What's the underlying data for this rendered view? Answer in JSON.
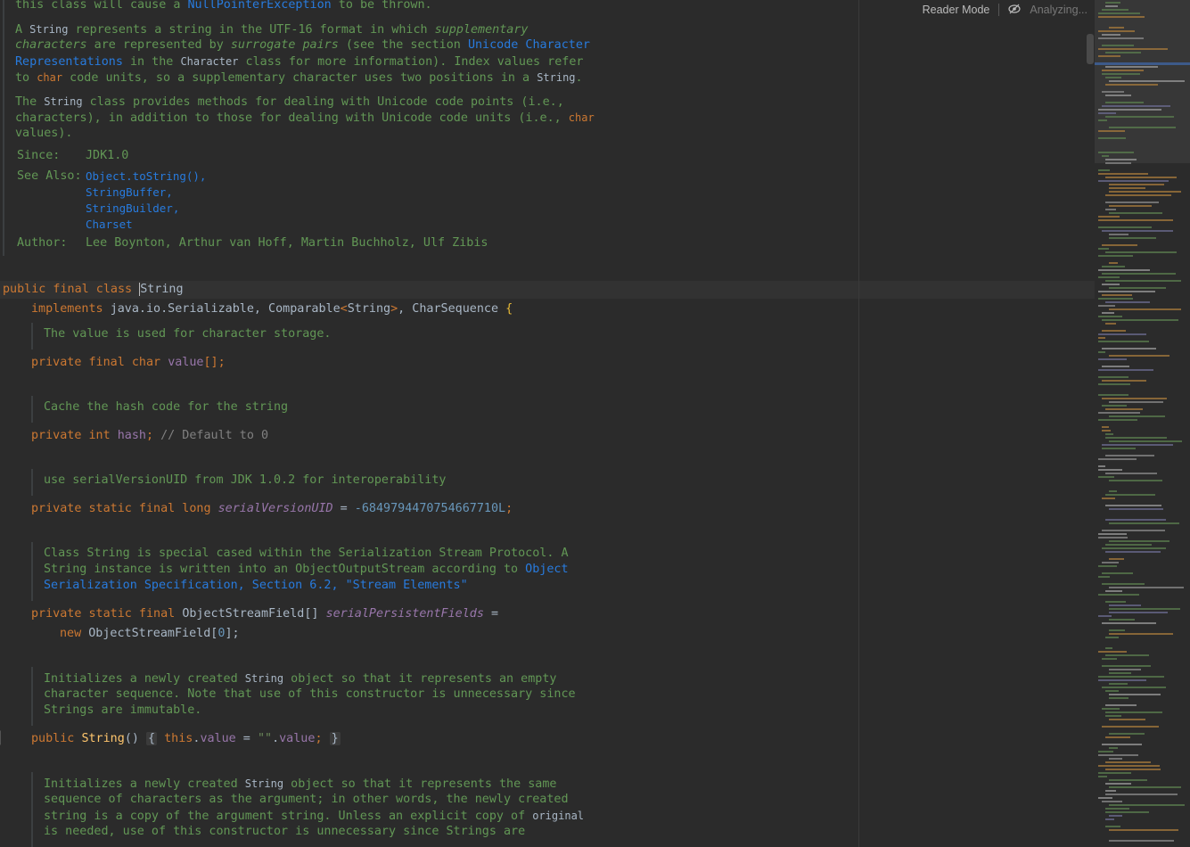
{
  "toolbar": {
    "reader_mode": "Reader Mode",
    "analyzing": "Analyzing..."
  },
  "doc_top": {
    "l1_a": "this class will cause a ",
    "l1_link": "NullPointerException",
    "l1_b": " to be thrown.",
    "p1_l1_a": "A ",
    "p1_l1_code": "String",
    "p1_l1_b": " represents a string in the UTF-16 format in which ",
    "p1_l1_i": "supplementary",
    "p1_l2_i": "characters",
    "p1_l2_a": " are represented by ",
    "p1_l2_i2": "surrogate pairs",
    "p1_l2_b": " (see the section ",
    "p1_l2_link": "Unicode Character",
    "p1_l3_link": "Representations",
    "p1_l3_a": " in the ",
    "p1_l3_code": "Character",
    "p1_l3_b": " class for more information). Index values refer",
    "p1_l4_a": "to ",
    "p1_l4_code": "char",
    "p1_l4_b": " code units, so a supplementary character uses two positions in a ",
    "p1_l4_code2": "String",
    "p1_l4_c": ".",
    "p2_l1_a": "The ",
    "p2_l1_code": "String",
    "p2_l1_b": " class provides methods for dealing with Unicode code points (i.e.,",
    "p2_l2_a": "characters), in addition to those for dealing with Unicode code units (i.e., ",
    "p2_l2_code": "char",
    "p2_l3": "values).",
    "since_label": "Since:",
    "since_value": "JDK1.0",
    "seealso_label": "See Also:",
    "seealso": [
      "Object.toString(),",
      "StringBuffer,",
      "StringBuilder,",
      "Charset"
    ],
    "author_label": "Author:",
    "author_value": "Lee Boynton, Arthur van Hoff, Martin Buchholz, Ulf Zibis"
  },
  "code": {
    "class_kw": "public final class ",
    "class_name": "String",
    "implements_kw": "implements ",
    "implements_a": "java.io.Serializable, Comparable",
    "implements_lt": "<",
    "implements_t": "String",
    "implements_gt": ">",
    "implements_b": ", CharSequence ",
    "brace": "{",
    "doc_value": "The value is used for character storage.",
    "value_kw": "private final char ",
    "value_name": "value",
    "value_end": "[];",
    "doc_hash": "Cache the hash code for the string",
    "hash_kw": "private int ",
    "hash_name": "hash",
    "hash_semi": "; ",
    "hash_cmt": "// Default to 0",
    "doc_serial": "use serialVersionUID from JDK 1.0.2 for interoperability",
    "serial_kw": "private static final long ",
    "serial_name": "serialVersionUID",
    "serial_eq": " = ",
    "serial_val": "-6849794470754667710L",
    "serial_semi": ";",
    "doc_spf_l1": "Class String is special cased within the Serialization Stream Protocol. A",
    "doc_spf_l2_a": "String instance is written into an ObjectOutputStream according to ",
    "doc_spf_l2_link": "Object",
    "doc_spf_l3_link": "Serialization Specification, Section 6.2, \"Stream Elements\"",
    "spf_kw": "private static final ",
    "spf_type": "ObjectStreamField[] ",
    "spf_name": "serialPersistentFields",
    "spf_eq": " =",
    "spf_new_kw": "new ",
    "spf_new_type": "ObjectStreamField[",
    "spf_new_num": "0",
    "spf_new_end": "];",
    "doc_ctor1_l1_a": "Initializes a newly created ",
    "doc_ctor1_l1_code": "String",
    "doc_ctor1_l1_b": " object so that it represents an empty",
    "doc_ctor1_l2": "character sequence. Note that use of this constructor is unnecessary since",
    "doc_ctor1_l3": "Strings are immutable.",
    "ctor1_kw": "public ",
    "ctor1_name": "String",
    "ctor1_paren": "() ",
    "ctor1_open": "{",
    "ctor1_this": " this",
    "ctor1_dot": ".",
    "ctor1_value": "value",
    "ctor1_eq": " = ",
    "ctor1_str": "\"\"",
    "ctor1_dot2": ".",
    "ctor1_value2": "value",
    "ctor1_semi": "; ",
    "ctor1_close": "}",
    "doc_ctor2_l1_a": "Initializes a newly created ",
    "doc_ctor2_l1_code": "String",
    "doc_ctor2_l1_b": " object so that it represents the same",
    "doc_ctor2_l2": "sequence of characters as the argument; in other words, the newly created",
    "doc_ctor2_l3_a": "string is a copy of the argument string. Unless an explicit copy of ",
    "doc_ctor2_l3_code": "original",
    "doc_ctor2_l4": "is needed, use of this constructor is unnecessary since Strings are"
  }
}
